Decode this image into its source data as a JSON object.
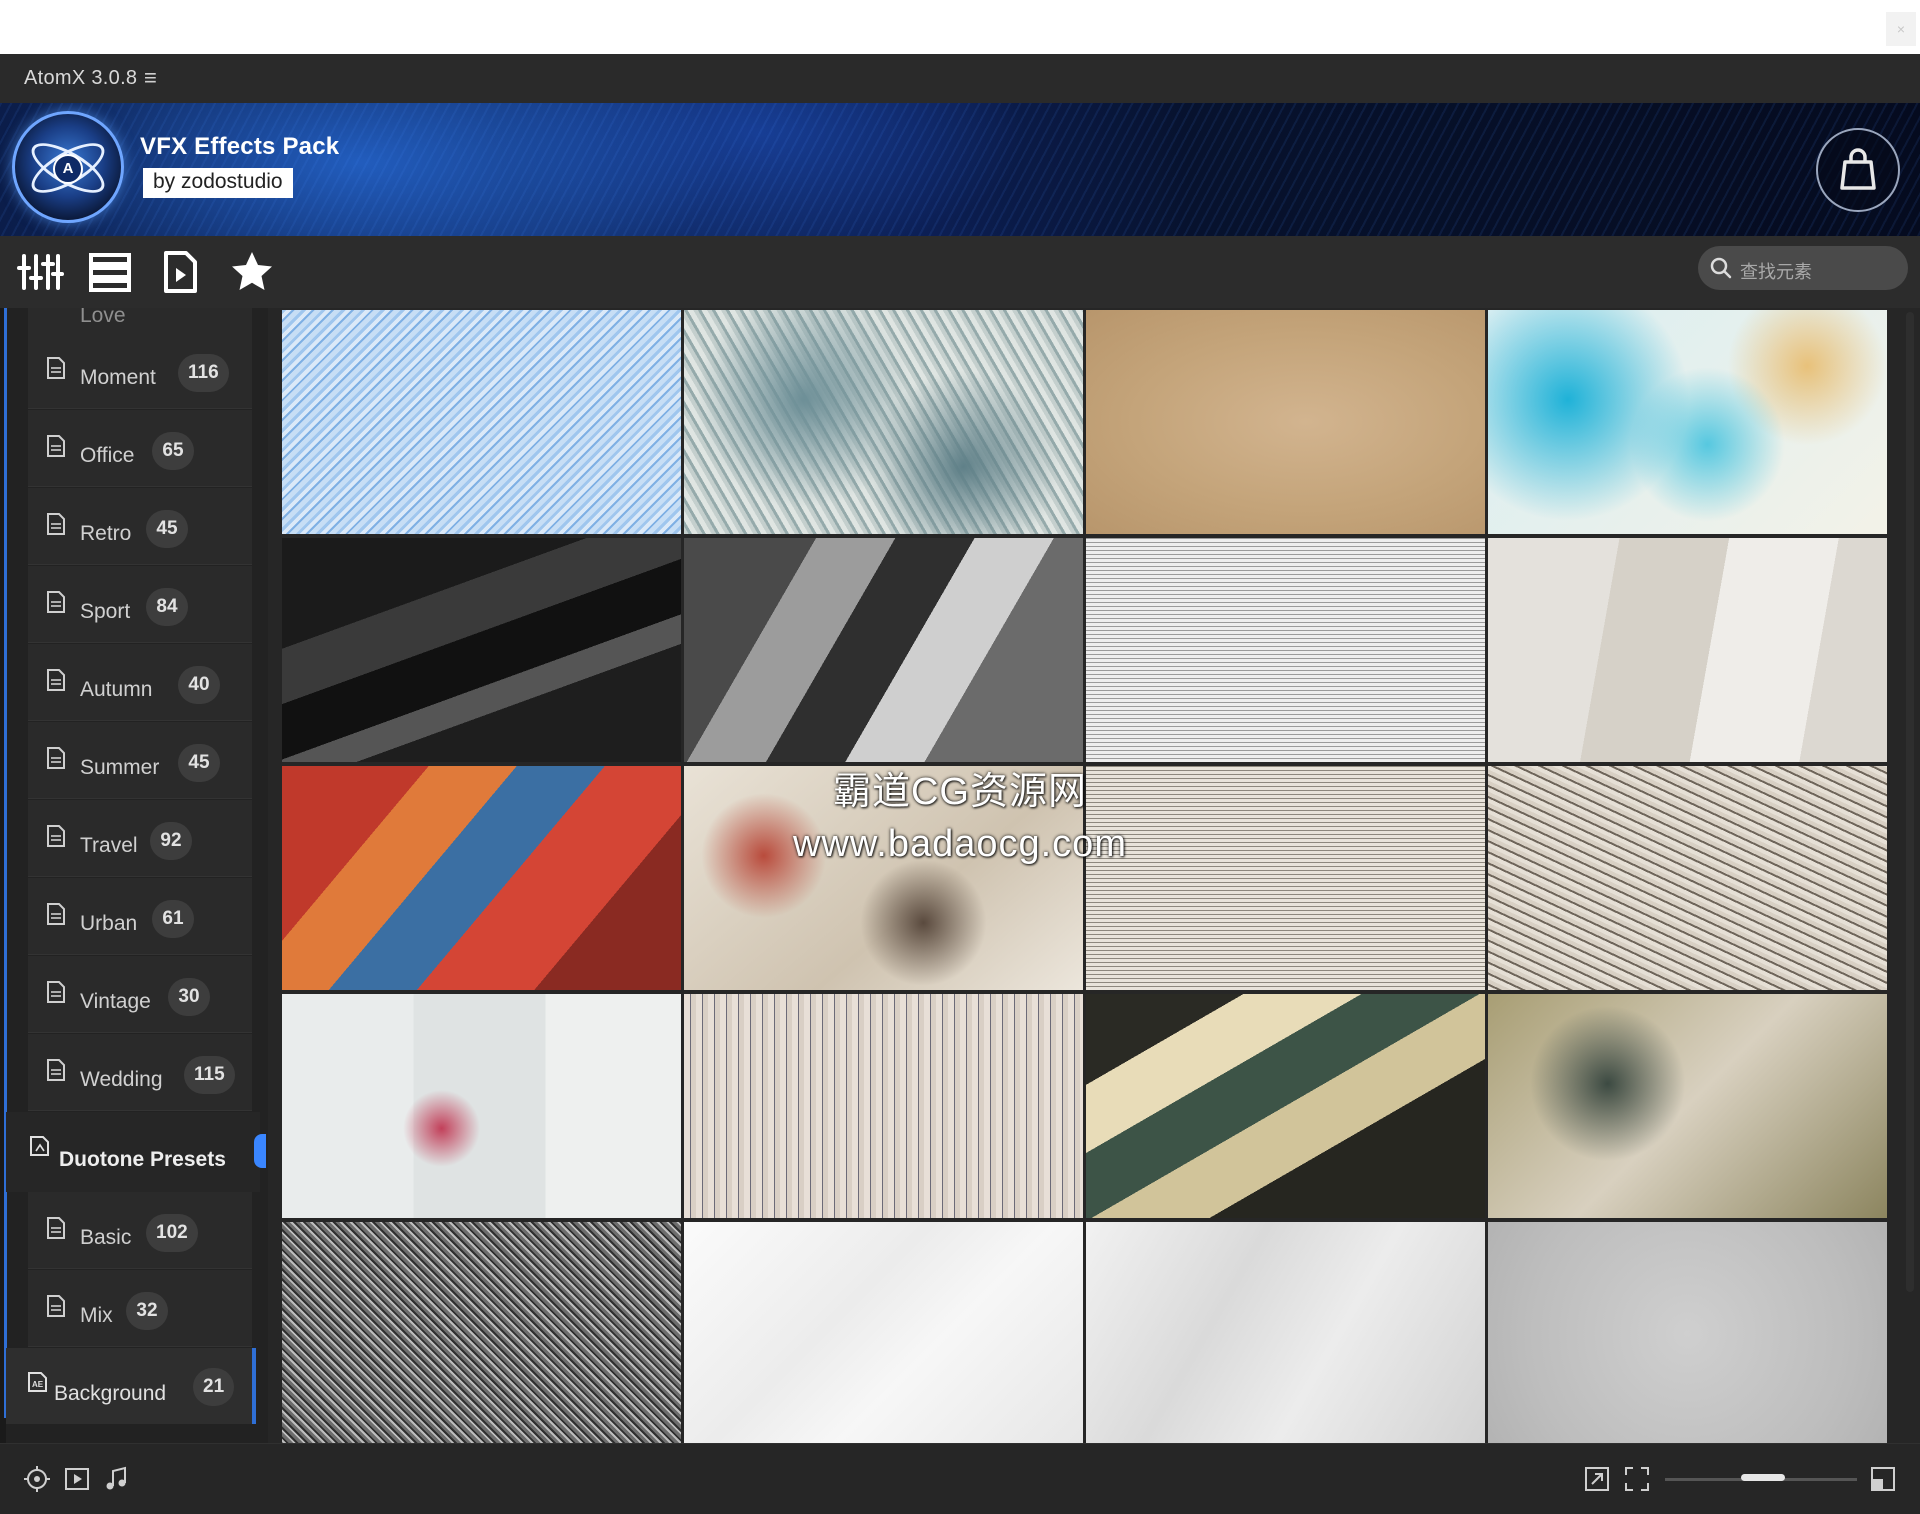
{
  "window": {
    "close_glyph": "×"
  },
  "app": {
    "title": "AtomX 3.0.8",
    "menu_glyph": "≡"
  },
  "banner": {
    "name": "VFX Effects Pack",
    "author": "by zodostudio",
    "logo_letter": "A"
  },
  "toolbar": {
    "icons": [
      "sliders-icon",
      "list-icon",
      "file-play-icon",
      "star-icon"
    ],
    "search_placeholder": "查找元素"
  },
  "sidebar": {
    "partial_item": {
      "label": "Love"
    },
    "items": [
      {
        "label": "Moment",
        "count": "116"
      },
      {
        "label": "Office",
        "count": "65"
      },
      {
        "label": "Retro",
        "count": "45"
      },
      {
        "label": "Sport",
        "count": "84"
      },
      {
        "label": "Autumn",
        "count": "40"
      },
      {
        "label": "Summer",
        "count": "45"
      },
      {
        "label": "Travel",
        "count": "92"
      },
      {
        "label": "Urban",
        "count": "61"
      },
      {
        "label": "Vintage",
        "count": "30"
      },
      {
        "label": "Wedding",
        "count": "115"
      }
    ],
    "group": {
      "label": "Duotone Presets"
    },
    "group_items": [
      {
        "label": "Basic",
        "count": "102"
      },
      {
        "label": "Mix",
        "count": "32"
      }
    ],
    "background": {
      "label": "Background",
      "count": "21"
    }
  },
  "grid": {
    "tiles": [
      "blue-snow-texture",
      "teal-grunge-texture",
      "kraft-paper-texture",
      "watercolor-teal-texture",
      "dark-collage-texture",
      "gray-collage-texture",
      "newspaper-collage-texture",
      "light-paper-collage-texture",
      "red-collage-texture",
      "torn-poster-texture",
      "newspaper-torn-texture",
      "newspaper-strips-texture",
      "letters-collage-texture",
      "distressed-print-texture",
      "vintage-poster-collage-texture",
      "olive-distressed-texture",
      "dark-grunge-texture",
      "crumpled-white-paper-texture",
      "crumpled-gray-paper-texture",
      "concrete-texture"
    ]
  },
  "watermark": {
    "line1": "霸道CG资源网",
    "line2": "www.badaocg.com"
  },
  "statusbar": {
    "left_icons": [
      "target-icon",
      "video-icon",
      "music-icon"
    ],
    "right_icons": [
      "resize-icon",
      "fullscreen-icon",
      "expand-icon"
    ]
  },
  "colors": {
    "accent": "#2f6fd6",
    "selection": "#3a86ff",
    "panel": "#262626"
  }
}
